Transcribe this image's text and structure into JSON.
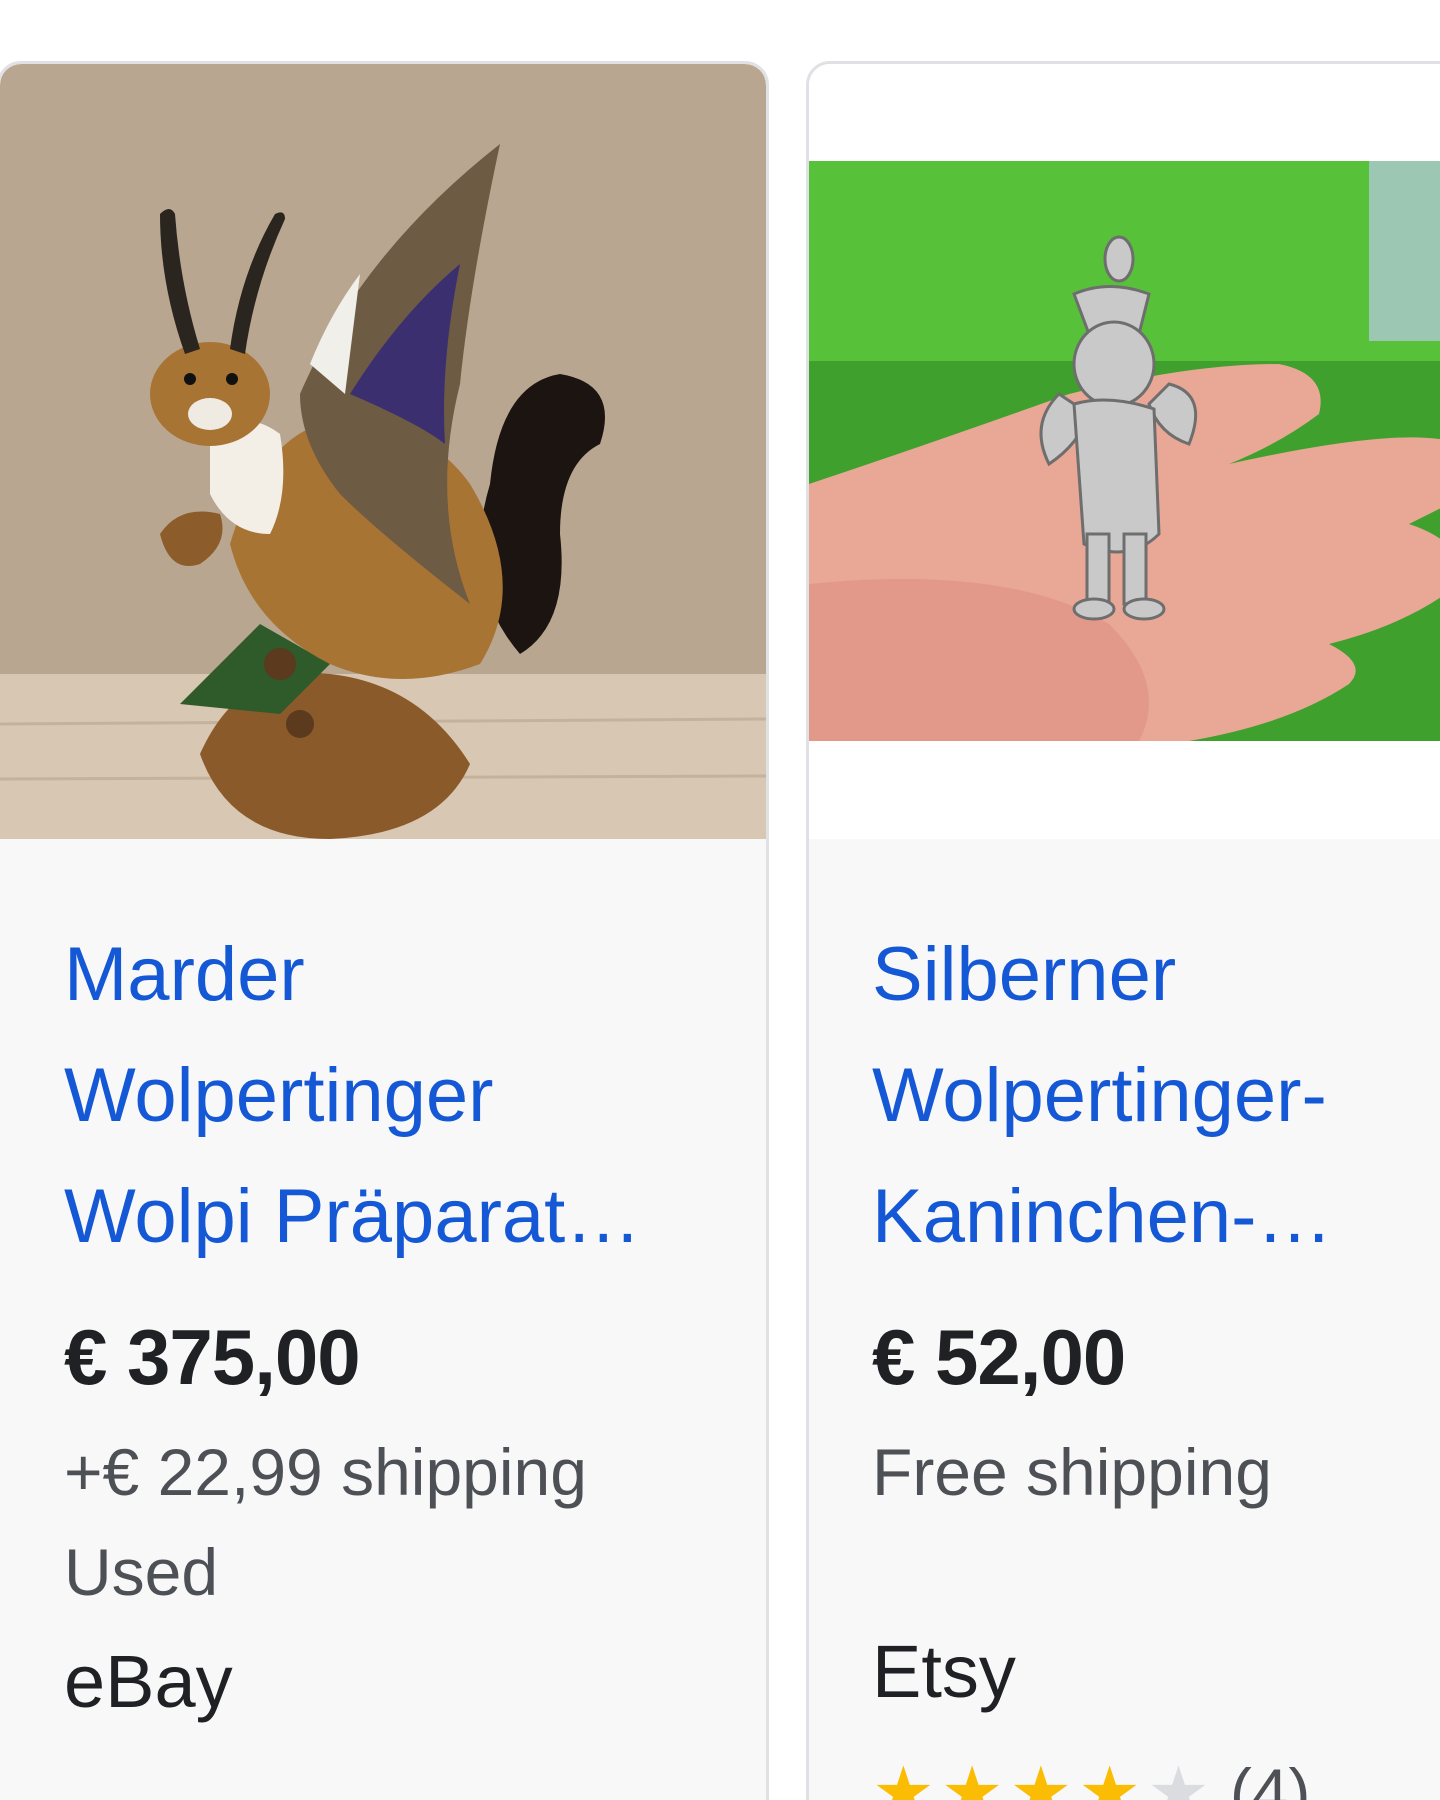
{
  "cards": [
    {
      "title_lines": [
        "Marder",
        "Wolpertinger",
        "Wolpi Präparat…"
      ],
      "price": "€ 375,00",
      "shipping": "+€ 22,99 shipping",
      "condition": "Used",
      "seller": "eBay",
      "image": "taxidermy-winged-horned-marten"
    },
    {
      "title_lines": [
        "Silberner",
        "Wolpertinger-",
        "Kaninchen-…"
      ],
      "price": "€ 52,00",
      "shipping": "Free shipping",
      "seller": "Etsy",
      "rating_count": "(4)",
      "image": "silver-wolpertinger-pendant-on-hand"
    }
  ],
  "colors": {
    "title": "#1558d6",
    "price": "#202124",
    "meta": "#4d5156",
    "star": "#fbbc04",
    "card_bg": "#f8f8f9",
    "card_border": "#dfe1e5"
  }
}
